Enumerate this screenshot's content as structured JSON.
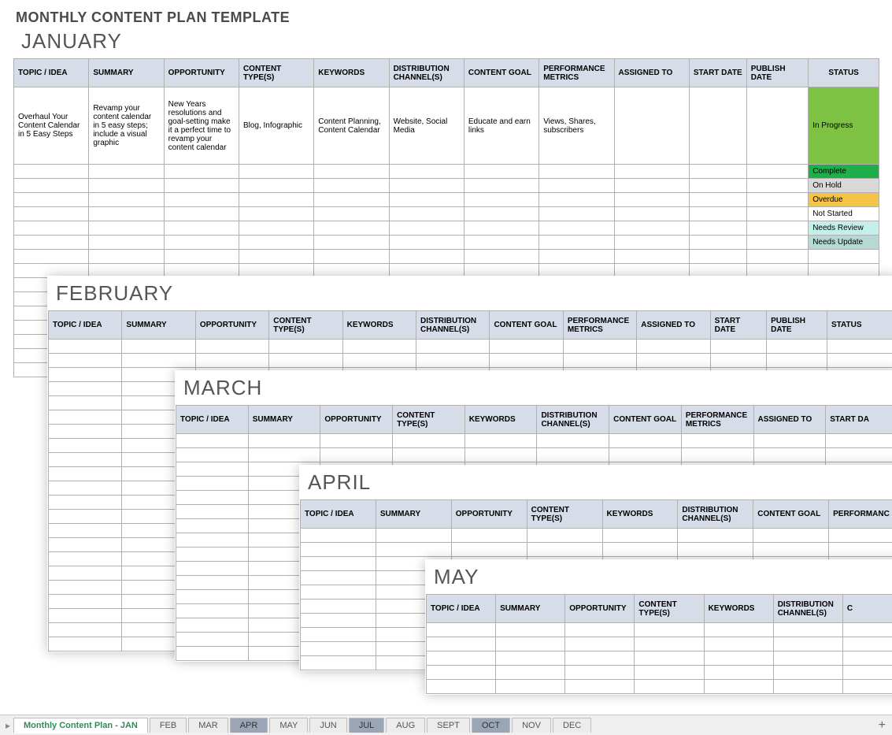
{
  "title": "MONTHLY CONTENT PLAN TEMPLATE",
  "headers": {
    "topic": "TOPIC / IDEA",
    "summary": "SUMMARY",
    "opportunity": "OPPORTUNITY",
    "type": "CONTENT TYPE(S)",
    "keywords": "KEYWORDS",
    "distribution": "DISTRIBUTION CHANNEL(S)",
    "goal": "CONTENT GOAL",
    "metrics": "PERFORMANCE METRICS",
    "assigned": "ASSIGNED TO",
    "start": "START DATE",
    "publish": "PUBLISH DATE",
    "status": "STATUS",
    "startda": "START DA",
    "startd": "START D",
    "performanc": "PERFORMANC",
    "c": "C"
  },
  "months": {
    "jan": "JANUARY",
    "feb": "FEBRUARY",
    "mar": "MARCH",
    "apr": "APRIL",
    "may": "MAY"
  },
  "january_row": {
    "topic": "Overhaul Your Content Calendar in 5 Easy Steps",
    "summary": "Revamp your content calendar in 5 easy steps; include a visual graphic",
    "opportunity": "New Years resolutions and goal-setting make it a perfect time to revamp your content calendar",
    "type": "Blog, Infographic",
    "keywords": "Content Planning, Content Calendar",
    "distribution": "Website, Social Media",
    "goal": "Educate and earn links",
    "metrics": "Views, Shares, subscribers",
    "assigned": "",
    "start": "",
    "publish": "",
    "status": "In Progress"
  },
  "status_list": {
    "complete": "Complete",
    "onhold": "On Hold",
    "overdue": "Overdue",
    "notstarted": "Not Started",
    "review": "Needs Review",
    "update": "Needs Update"
  },
  "tabs": {
    "active": "Monthly Content Plan - JAN",
    "feb": "FEB",
    "mar": "MAR",
    "apr": "APR",
    "may": "MAY",
    "jun": "JUN",
    "jul": "JUL",
    "aug": "AUG",
    "sept": "SEPT",
    "oct": "OCT",
    "nov": "NOV",
    "dec": "DEC"
  }
}
